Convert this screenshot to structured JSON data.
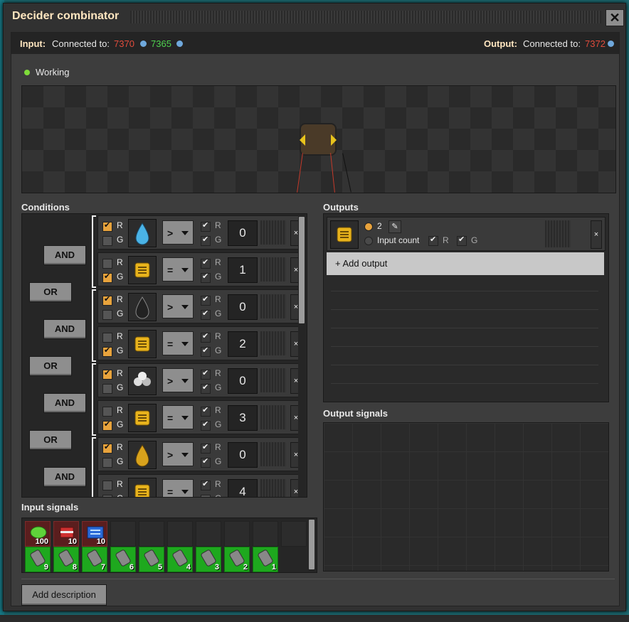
{
  "window": {
    "title": "Decider combinator",
    "close": "✕"
  },
  "connection": {
    "input_label": "Input:",
    "input_connected": "Connected to:",
    "input_red": "7370",
    "input_green": "7365",
    "output_label": "Output:",
    "output_connected": "Connected to:",
    "output_red": "7372"
  },
  "status": {
    "text": "Working"
  },
  "conditions": {
    "header": "Conditions",
    "rows": [
      {
        "r": true,
        "g": false,
        "icon": "water-icon",
        "op": ">",
        "rw": true,
        "gw": true,
        "value": "0"
      },
      {
        "r": false,
        "g": true,
        "icon": "chip-signal-icon",
        "op": "=",
        "rw": true,
        "gw": true,
        "value": "1"
      },
      {
        "r": true,
        "g": false,
        "icon": "crude-oil-icon",
        "op": ">",
        "rw": true,
        "gw": true,
        "value": "0"
      },
      {
        "r": false,
        "g": true,
        "icon": "chip-signal-icon",
        "op": "=",
        "rw": true,
        "gw": true,
        "value": "2"
      },
      {
        "r": true,
        "g": false,
        "icon": "molecule-icon",
        "op": ">",
        "rw": true,
        "gw": true,
        "value": "0"
      },
      {
        "r": false,
        "g": true,
        "icon": "chip-signal-icon",
        "op": "=",
        "rw": true,
        "gw": true,
        "value": "3"
      },
      {
        "r": true,
        "g": false,
        "icon": "oil-drop-icon",
        "op": ">",
        "rw": true,
        "gw": true,
        "value": "0"
      },
      {
        "r": false,
        "g": false,
        "icon": "chip-signal-icon",
        "op": "=",
        "rw": true,
        "gw": false,
        "value": "4"
      }
    ],
    "logic": [
      "AND",
      "OR",
      "AND",
      "OR",
      "AND",
      "OR",
      "AND"
    ],
    "r_label": "R",
    "g_label": "G",
    "remove": "×"
  },
  "outputs": {
    "header": "Outputs",
    "value": "2",
    "input_count": "Input count",
    "r_label": "R",
    "g_label": "G",
    "remove": "×",
    "add_output": "+ Add output"
  },
  "output_signals": {
    "header": "Output signals"
  },
  "input_signals": {
    "header": "Input signals",
    "red": [
      {
        "icon": "green-blob-icon",
        "count": "100"
      },
      {
        "icon": "explosive-icon",
        "count": "10"
      },
      {
        "icon": "circuit-icon",
        "count": "10"
      }
    ],
    "green": [
      {
        "icon": "barrel-icon",
        "count": "9"
      },
      {
        "icon": "barrel-icon",
        "count": "8"
      },
      {
        "icon": "barrel-icon",
        "count": "7"
      },
      {
        "icon": "barrel-icon",
        "count": "6"
      },
      {
        "icon": "barrel-icon",
        "count": "5"
      },
      {
        "icon": "barrel-icon",
        "count": "4"
      },
      {
        "icon": "barrel-icon",
        "count": "3"
      },
      {
        "icon": "barrel-icon",
        "count": "2"
      },
      {
        "icon": "barrel-icon",
        "count": "1"
      }
    ]
  },
  "description_button": "Add description",
  "colors": {
    "accent": "#e8a33c",
    "red_wire": "#e04c3c",
    "green_wire": "#4fd24f",
    "working": "#7fdc3a"
  }
}
